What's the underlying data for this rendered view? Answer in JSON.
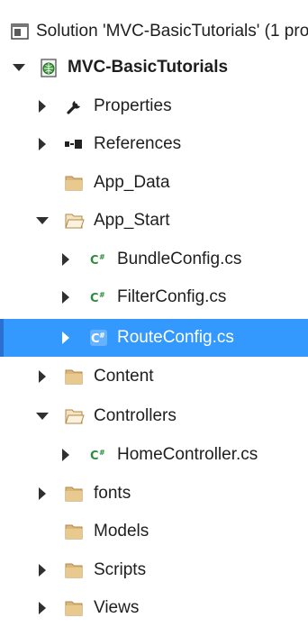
{
  "solution_explorer": {
    "solution_label": "Solution 'MVC-BasicTutorials' (1 pro",
    "project_label": "MVC-BasicTutorials",
    "items": [
      {
        "label": "Properties"
      },
      {
        "label": "References"
      },
      {
        "label": "App_Data"
      },
      {
        "label": "App_Start"
      },
      {
        "label": "BundleConfig.cs"
      },
      {
        "label": "FilterConfig.cs"
      },
      {
        "label": "RouteConfig.cs"
      },
      {
        "label": "Content"
      },
      {
        "label": "Controllers"
      },
      {
        "label": "HomeController.cs"
      },
      {
        "label": "fonts"
      },
      {
        "label": "Models"
      },
      {
        "label": "Scripts"
      },
      {
        "label": "Views"
      }
    ],
    "colors": {
      "selection": "#3399ff",
      "folder": "#dcb67a",
      "csharp_green": "#2e8b3a",
      "text": "#1e1e1e"
    }
  }
}
